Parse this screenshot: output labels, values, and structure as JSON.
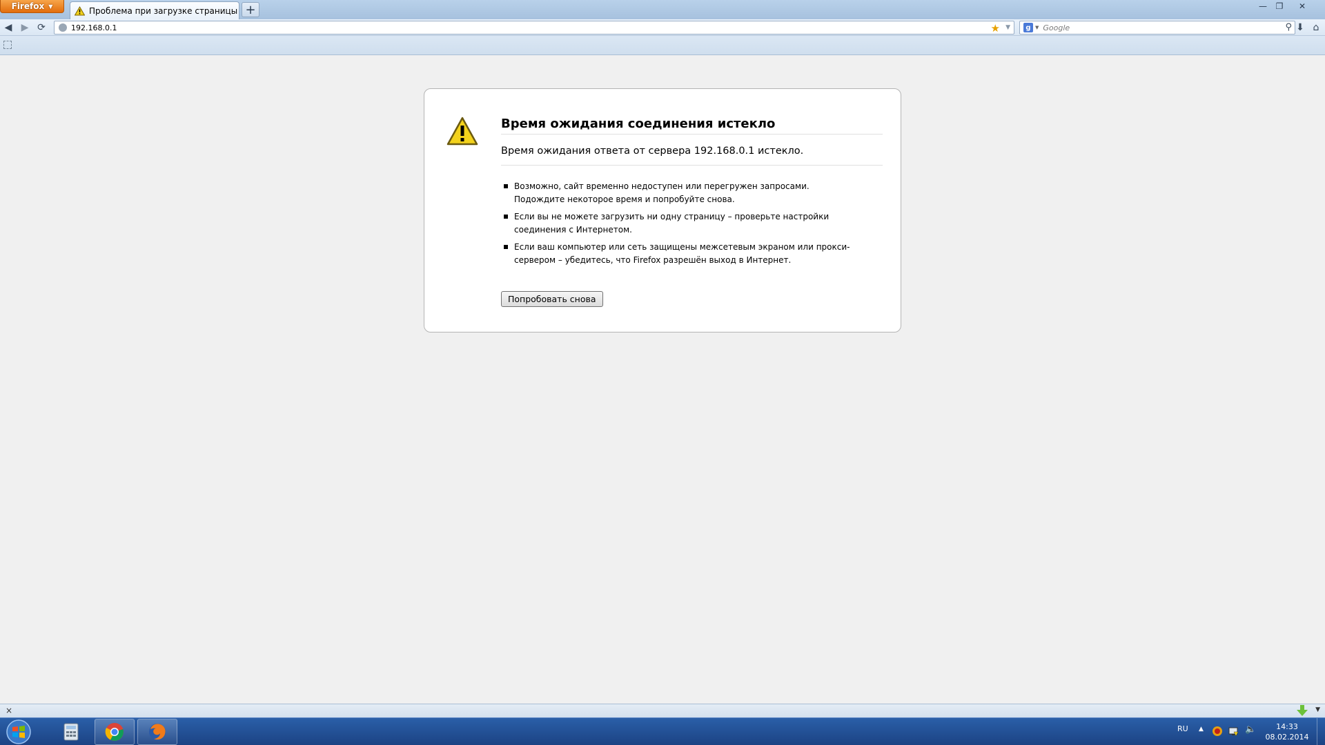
{
  "browser": {
    "app_button_label": "Firefox",
    "tab_title": "Проблема при загрузке страницы",
    "new_tab_label": "+",
    "url": "192.168.0.1",
    "search_placeholder": "Google",
    "search_engine_letter": "g"
  },
  "error": {
    "title": "Время ожидания соединения истекло",
    "description": "Время ожидания ответа от сервера 192.168.0.1 истекло.",
    "bullets": [
      "Возможно, сайт временно недоступен или перегружен запросами. Подождите некоторое время и попробуйте снова.",
      "Если вы не можете загрузить ни одну страницу – проверьте настройки соединения с Интернетом.",
      "Если ваш компьютер или сеть защищены межсетевым экраном или прокси-сервером – убедитесь, что Firefox разрешён выход в Интернет."
    ],
    "retry_button": "Попробовать снова"
  },
  "statusbar": {
    "close_label": "×"
  },
  "taskbar": {
    "language": "RU",
    "time": "14:33",
    "date": "08.02.2014",
    "pinned": [
      "calculator-icon",
      "chrome-icon",
      "firefox-icon"
    ]
  },
  "colors": {
    "accent_orange": "#e26d0c",
    "taskbar_blue": "#1c4384",
    "warning_yellow": "#f3d21c"
  }
}
